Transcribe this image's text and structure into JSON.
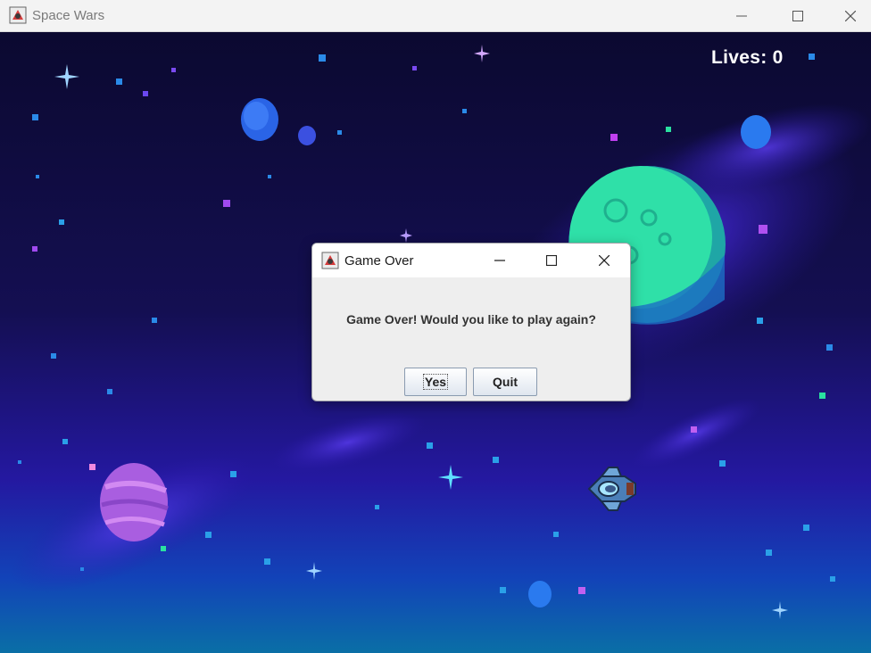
{
  "window": {
    "title": "Space Wars"
  },
  "hud": {
    "lives_text": "Lives: 0"
  },
  "dialog": {
    "title": "Game Over",
    "message": "Game Over! Would you like to play again?",
    "yes_label": "Yes",
    "quit_label": "Quit"
  },
  "colors": {
    "sky_top": "#0c0a33",
    "sky_bottom": "#0a6fa6",
    "nebula": "#3b22c9",
    "planet_green": "#2fe0a8",
    "planet_pink": "#b070e8",
    "planet_blue": "#2a64e6"
  }
}
